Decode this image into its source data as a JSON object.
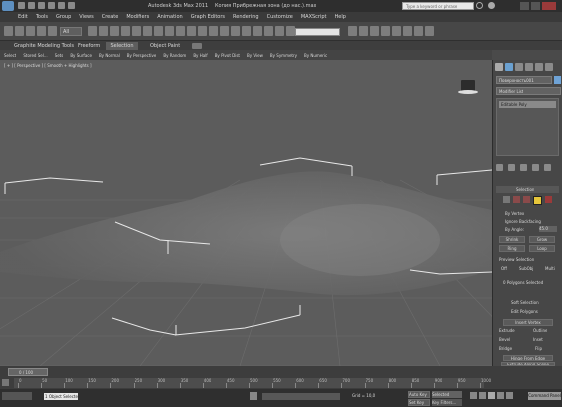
{
  "app": {
    "title": "Autodesk 3ds Max 2011",
    "file": "Копия Прибрежная зона (до нас.).max",
    "search_placeholder": "Type a keyword or phrase"
  },
  "menu": [
    "Edit",
    "Tools",
    "Group",
    "Views",
    "Create",
    "Modifiers",
    "Animation",
    "Graph Editors",
    "Rendering",
    "Customize",
    "MAXScript",
    "Help"
  ],
  "toolbar": {
    "selection_filter": "All",
    "named_selection": ""
  },
  "ribbon": {
    "tabs": [
      "Graphite Modeling Tools",
      "Freeform",
      "Selection",
      "Object Paint"
    ],
    "active_tab": "Selection",
    "items": [
      "Select",
      "Stored Sel...",
      "Sets",
      "By Surface",
      "By Normal",
      "By Perspective",
      "By Random",
      "By Half",
      "By Pivot Dist",
      "By View",
      "By Symmetry",
      "By Numeric"
    ]
  },
  "viewport": {
    "label": "[ + ] [ Perspective ] [ Smooth + Highlights ]"
  },
  "command_panel": {
    "object_name": "Поверхность001",
    "modifier_list": "Modifier List",
    "stack_item": "Editable Poly",
    "rollout_selection": "Selection",
    "by_vertex": "By Vertex",
    "ignore_backfacing": "Ignore Backfacing",
    "by_angle": "By Angle:",
    "by_angle_value": "45.0",
    "shrink": "Shrink",
    "grow": "Grow",
    "ring": "Ring",
    "loop": "Loop",
    "preview_selection": "Preview Selection",
    "off": "Off",
    "subobj": "SubObj",
    "multi": "Multi",
    "selected_count": "0 Polygons Selected",
    "soft_selection": "Soft Selection",
    "edit_polygons": "Edit Polygons",
    "insert_vertex": "Insert Vertex",
    "extrude": "Extrude",
    "outline": "Outline",
    "bevel": "Bevel",
    "inset": "Inset",
    "bridge": "Bridge",
    "flip": "Flip",
    "hinge_from_edge": "Hinge From Edge",
    "extrude_along_spline": "Extrude Along Spline"
  },
  "timeline": {
    "frame": "0 / 100",
    "ticks": [
      "0",
      "50",
      "100",
      "150",
      "200",
      "250",
      "300",
      "350",
      "400",
      "450",
      "500",
      "550",
      "600",
      "650",
      "700",
      "750",
      "800",
      "850",
      "900",
      "950",
      "1000"
    ],
    "progress": 0.0
  },
  "statusbar": {
    "status": "1 Object Selected",
    "grid": "Grid = 10,0",
    "auto_key": "Auto Key",
    "set_key": "Set Key",
    "key_mode": "Selected",
    "key_filters": "Key Filters...",
    "panel_btn": "Command Panel"
  }
}
